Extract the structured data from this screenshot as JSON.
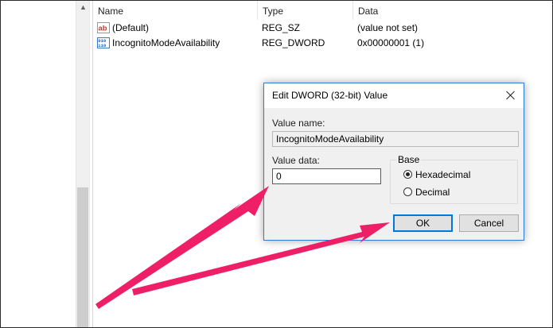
{
  "list": {
    "columns": [
      "Name",
      "Type",
      "Data"
    ],
    "rows": [
      {
        "icon": "string-value-icon",
        "name": "(Default)",
        "type": "REG_SZ",
        "data": "(value not set)"
      },
      {
        "icon": "binary-value-icon",
        "name": "IncognitoModeAvailability",
        "type": "REG_DWORD",
        "data": "0x00000001 (1)"
      }
    ]
  },
  "dialog": {
    "title": "Edit DWORD (32-bit) Value",
    "value_name_label": "Value name:",
    "value_name": "IncognitoModeAvailability",
    "value_data_label": "Value data:",
    "value_data": "0",
    "base_label": "Base",
    "base_options": [
      {
        "label": "Hexadecimal",
        "selected": true
      },
      {
        "label": "Decimal",
        "selected": false
      }
    ],
    "ok_label": "OK",
    "cancel_label": "Cancel"
  },
  "annotation": {
    "arrow_color": "#ee1f66"
  }
}
